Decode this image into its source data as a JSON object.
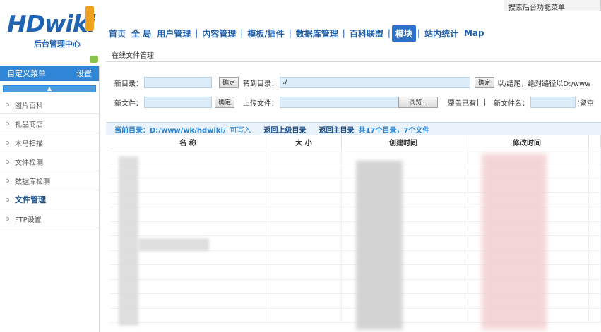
{
  "header": {
    "logo_text": "HDwiki",
    "logo_subtitle": "后台管理中心",
    "search_label": "搜索后台功能菜单"
  },
  "nav": {
    "items": [
      "首页",
      "全 局",
      "用户管理",
      "内容管理",
      "模板/插件",
      "数据库管理",
      "百科联盟",
      "模块",
      "站内统计",
      "Map"
    ],
    "active": "模块"
  },
  "sidebar": {
    "title": "自定义菜单",
    "settings_label": "设置",
    "items": [
      "图片百科",
      "礼品商店",
      "木马扫描",
      "文件检测",
      "数据库检测",
      "文件管理",
      "FTP设置"
    ],
    "active": "文件管理"
  },
  "main": {
    "breadcrumb": "在线文件管理",
    "new_dir_label": "新目录：",
    "new_dir_value": "",
    "confirm_label": "确定",
    "goto_dir_label": "转到目录：",
    "goto_dir_value": "./",
    "goto_hint": "以/结尾，绝对路径以D:/www",
    "new_file_label": "新文件：",
    "new_file_value": "",
    "upload_label": "上传文件：",
    "upload_value": "",
    "browse_label": "浏览...",
    "overwrite_label": "覆盖已有",
    "new_filename_label": "新文件名：",
    "new_filename_value": "",
    "new_filename_hint": "(留空",
    "current_dir_label": "当前目录：D:/www/wk/hdwiki/",
    "writable_label": "可写入",
    "up_link": "返回上级目录",
    "home_link": "返回主目录",
    "summary": "共17个目录，7个文件"
  },
  "table": {
    "headers": [
      "名 称",
      "大 小",
      "创建时间",
      "修改时间"
    ]
  }
}
